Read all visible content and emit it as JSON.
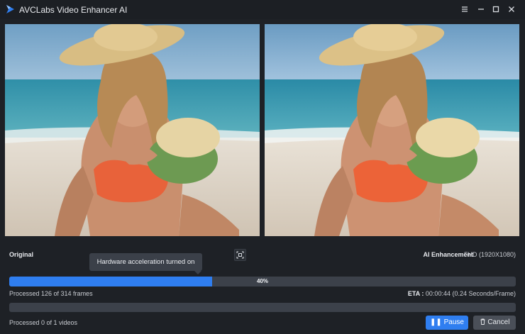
{
  "window": {
    "title": "AVCLabs Video Enhancer AI",
    "controls": [
      "menu-icon",
      "minimize-icon",
      "maximize-icon",
      "close-icon"
    ]
  },
  "preview": {
    "original_label": "Original",
    "enhanced_label": "AI Enhancement",
    "resolution_label": "FHD (1920X1080)"
  },
  "tooltip": {
    "text": "Hardware acceleration turned on"
  },
  "progress": {
    "percent": 40,
    "percent_label": "40%",
    "frames_text": "Processed 126 of 314 frames",
    "eta_label": "ETA :",
    "eta_value": "00:00:44 (0.24 Seconds/Frame)"
  },
  "batch": {
    "percent": 0,
    "videos_text": "Processed 0 of 1 videos"
  },
  "buttons": {
    "pause": "Pause",
    "cancel": "Cancel"
  },
  "colors": {
    "accent": "#2f7ef0",
    "background": "#1e2126",
    "track": "#3c414a"
  }
}
